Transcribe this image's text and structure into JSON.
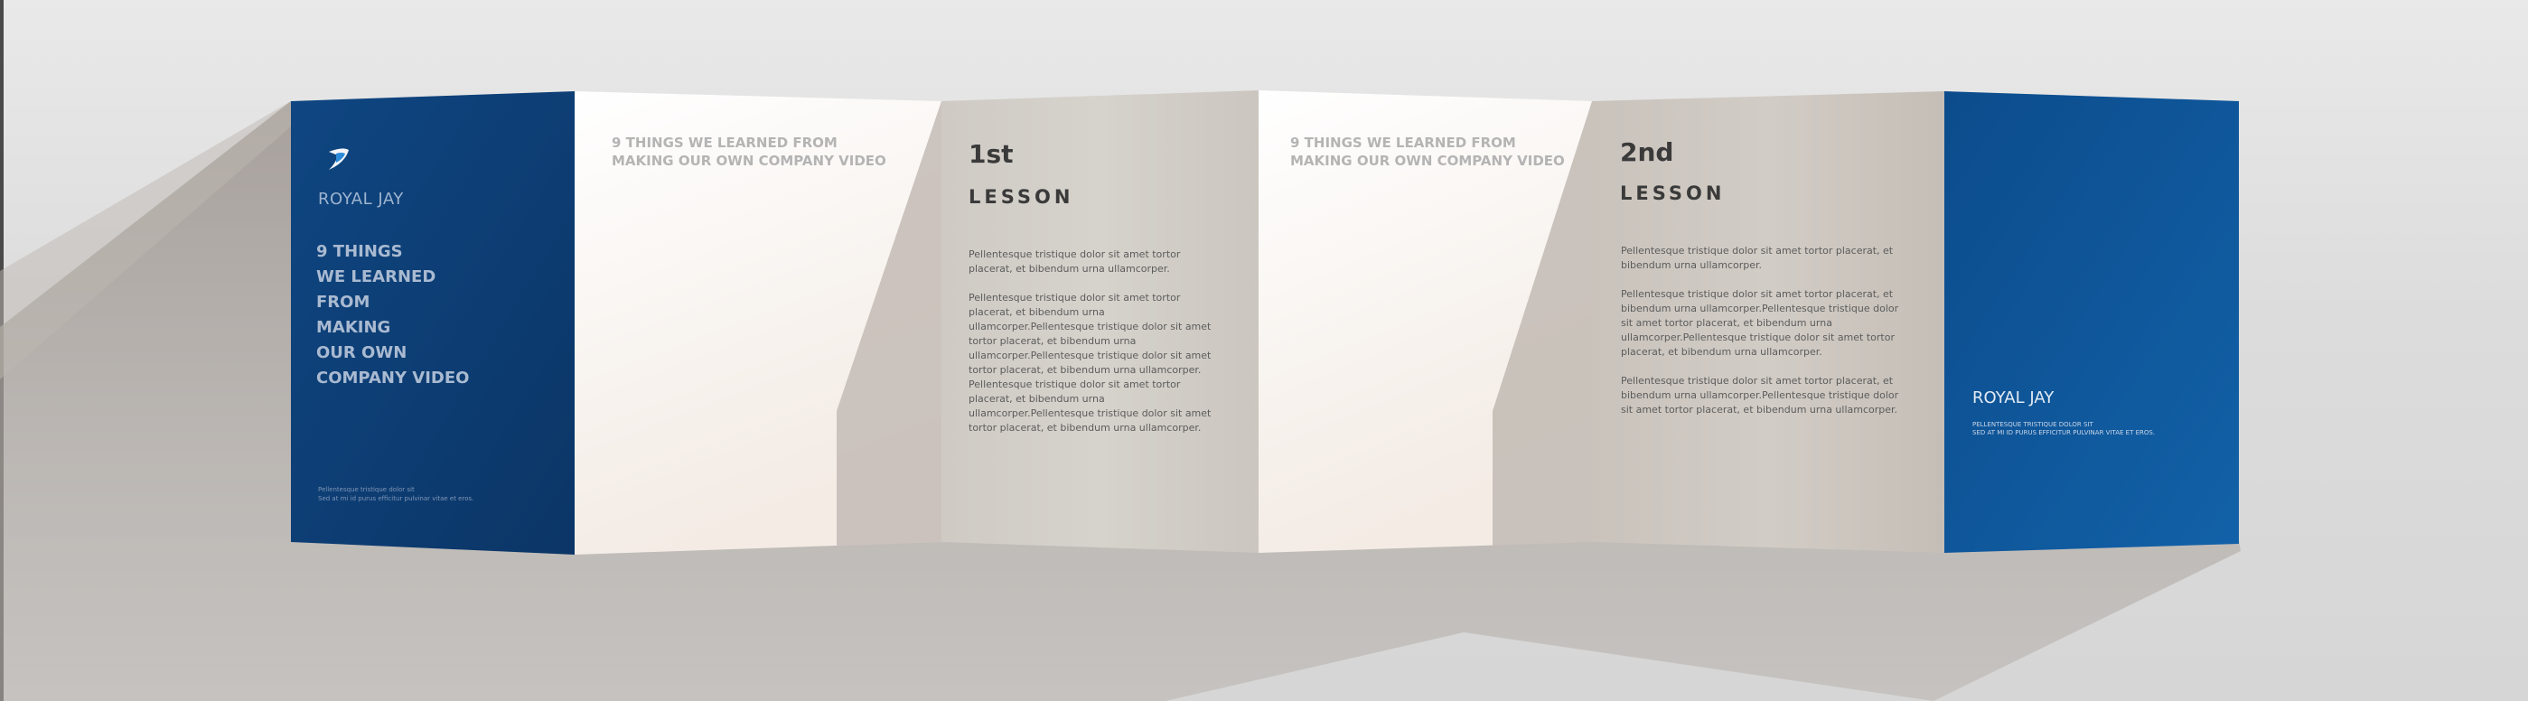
{
  "cover": {
    "brand": "ROYAL JAY",
    "title_lines": [
      "9 THINGS",
      "WE LEARNED",
      "FROM",
      "MAKING",
      "OUR OWN",
      "COMPANY VIDEO"
    ],
    "small_lines": [
      "Pellentesque tristique dolor sit",
      "Sed at mi id purus efficitur pulvinar vitae et eros."
    ]
  },
  "panel_heads": {
    "first": "9 THINGS WE LEARNED FROM MAKING OUR OWN COMPANY VIDEO",
    "second": "9 THINGS WE LEARNED FROM MAKING OUR OWN COMPANY VIDEO"
  },
  "lesson1": {
    "number": "1st",
    "word": "LESSON",
    "paragraphs": [
      "Pellentesque tristique dolor sit amet tortor placerat, et bibendum urna ullamcorper.",
      "Pellentesque tristique dolor sit amet tortor placerat, et bibendum urna ullamcorper.Pellentesque tristique dolor sit amet tortor placerat, et bibendum urna ullamcorper.Pellentesque tristique dolor sit amet tortor placerat, et bibendum urna ullamcorper.",
      "Pellentesque tristique dolor sit amet tortor placerat, et bibendum urna ullamcorper.Pellentesque tristique dolor sit amet tortor placerat, et bibendum urna ullamcorper."
    ]
  },
  "lesson2": {
    "number": "2nd",
    "word": "LESSON",
    "paragraphs": [
      "Pellentesque tristique dolor sit amet tortor placerat, et bibendum urna ullamcorper.",
      "Pellentesque tristique dolor sit amet tortor placerat, et bibendum urna ullamcorper.Pellentesque tristique dolor sit amet tortor placerat, et bibendum urna ullamcorper.Pellentesque tristique dolor sit amet tortor placerat, et bibendum urna ullamcorper.",
      "Pellentesque tristique dolor sit amet tortor placerat, et bibendum urna ullamcorper.Pellentesque tristique dolor sit amet tortor placerat, et bibendum urna ullamcorper."
    ]
  },
  "back": {
    "brand": "ROYAL JAY",
    "small_lines": [
      "Pellentesque tristique dolor sit",
      "Sed at mi id purus efficitur pulvinar vitae et eros."
    ]
  },
  "colors": {
    "navy": "#0e3f78",
    "blue": "#1058a0",
    "panel_grey": "#d1ccc6",
    "panel_white": "#f7f4f1"
  },
  "icons": {
    "logo": "royal-jay-bird-logo"
  }
}
